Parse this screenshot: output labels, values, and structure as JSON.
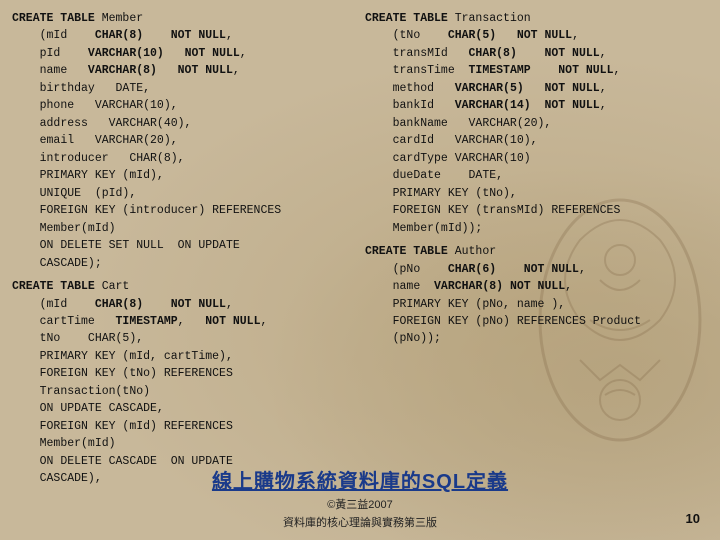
{
  "left_column": {
    "blocks": [
      {
        "id": "create-member",
        "lines": [
          {
            "text": "CREATE TABLE Member",
            "bold_words": [
              "CREATE",
              "TABLE"
            ]
          },
          {
            "text": "    (mId    CHAR(8)    NOT NULL,",
            "bold_ranges": [
              [
                5,
                8
              ],
              [
                19,
                27
              ]
            ]
          },
          {
            "text": "    pId    VARCHAR(10)   NOT NULL,",
            "bold_ranges": []
          },
          {
            "text": "    name   VARCHAR(8)   NOT NULL,",
            "bold_ranges": []
          },
          {
            "text": "    birthday   DATE,",
            "bold_ranges": []
          },
          {
            "text": "    phone   VARCHAR(10),",
            "bold_ranges": []
          },
          {
            "text": "    address   VARCHAR(40),",
            "bold_ranges": []
          },
          {
            "text": "    email   VARCHAR(20),",
            "bold_ranges": []
          },
          {
            "text": "    introducer   CHAR(8),",
            "bold_ranges": []
          },
          {
            "text": "    PRIMARY KEY (mId),",
            "bold_ranges": []
          },
          {
            "text": "    UNIQUE  (pId),",
            "bold_ranges": []
          },
          {
            "text": "    FOREIGN KEY (introducer) REFERENCES",
            "bold_ranges": []
          },
          {
            "text": "    Member(mId)",
            "bold_ranges": []
          },
          {
            "text": "    ON DELETE SET NULL  ON UPDATE",
            "bold_ranges": []
          },
          {
            "text": "    CASCADE);",
            "bold_ranges": []
          }
        ]
      },
      {
        "id": "create-cart",
        "lines": [
          {
            "text": "CREATE TABLE Cart",
            "bold_words": [
              "CREATE",
              "TABLE"
            ]
          },
          {
            "text": "    (mId    CHAR(8)    NOT NULL,",
            "bold_ranges": []
          },
          {
            "text": "    cartTime   TIMESTAMP,   NOT NULL,",
            "bold_ranges": []
          },
          {
            "text": "    tNo    CHAR(5),",
            "bold_ranges": []
          },
          {
            "text": "    PRIMARY KEY (mId, cartTime),",
            "bold_ranges": []
          },
          {
            "text": "    FOREIGN KEY (tNo) REFERENCES",
            "bold_ranges": []
          },
          {
            "text": "    Transaction(tNo)",
            "bold_ranges": []
          },
          {
            "text": "    ON UPDATE CASCADE,",
            "bold_ranges": []
          },
          {
            "text": "    FOREIGN KEY (mId) REFERENCES",
            "bold_ranges": []
          },
          {
            "text": "    Member(mId)",
            "bold_ranges": []
          },
          {
            "text": "    ON DELETE CASCADE  ON UPDATE",
            "bold_ranges": []
          },
          {
            "text": "    CASCADE),",
            "bold_ranges": []
          }
        ]
      }
    ]
  },
  "right_column": {
    "blocks": [
      {
        "id": "create-transaction",
        "lines": [
          {
            "text": "CREATE TABLE Transaction"
          },
          {
            "text": "    (tNo    CHAR(5)   NOT NULL,"
          },
          {
            "text": "    transMId   CHAR(8)    NOT NULL,"
          },
          {
            "text": "    transTime  TIMESTAMP    NOT NULL,"
          },
          {
            "text": "    method   VARCHAR(5)   NOT NULL,"
          },
          {
            "text": "    bankId   VARCHAR(14)  NOT NULL,"
          },
          {
            "text": "    bankName   VARCHAR(20),"
          },
          {
            "text": "    cardId   VARCHAR(10),"
          },
          {
            "text": "    cardType VARCHAR(10)"
          },
          {
            "text": "    dueDate    DATE,"
          },
          {
            "text": "    PRIMARY KEY (tNo),"
          },
          {
            "text": "    FOREIGN KEY (transMId) REFERENCES"
          },
          {
            "text": "    Member(mId));"
          }
        ]
      },
      {
        "id": "create-author",
        "lines": [
          {
            "text": "CREATE TABLE Author"
          },
          {
            "text": "    (pNo    CHAR(6)    NOT NULL,"
          },
          {
            "text": "    name  VARCHAR(8) NOT NULL,"
          },
          {
            "text": "    PRIMARY KEY (pNo, name ),"
          },
          {
            "text": "    FOREIGN KEY (pNo) REFERENCES Product"
          },
          {
            "text": "    (pNo));"
          }
        ]
      }
    ]
  },
  "footer": {
    "title": "線上購物系統資料庫的SQL定義",
    "sub1": "©黃三益2007",
    "sub2": "資料庫的核心理論與實務第三版",
    "page": "10"
  }
}
